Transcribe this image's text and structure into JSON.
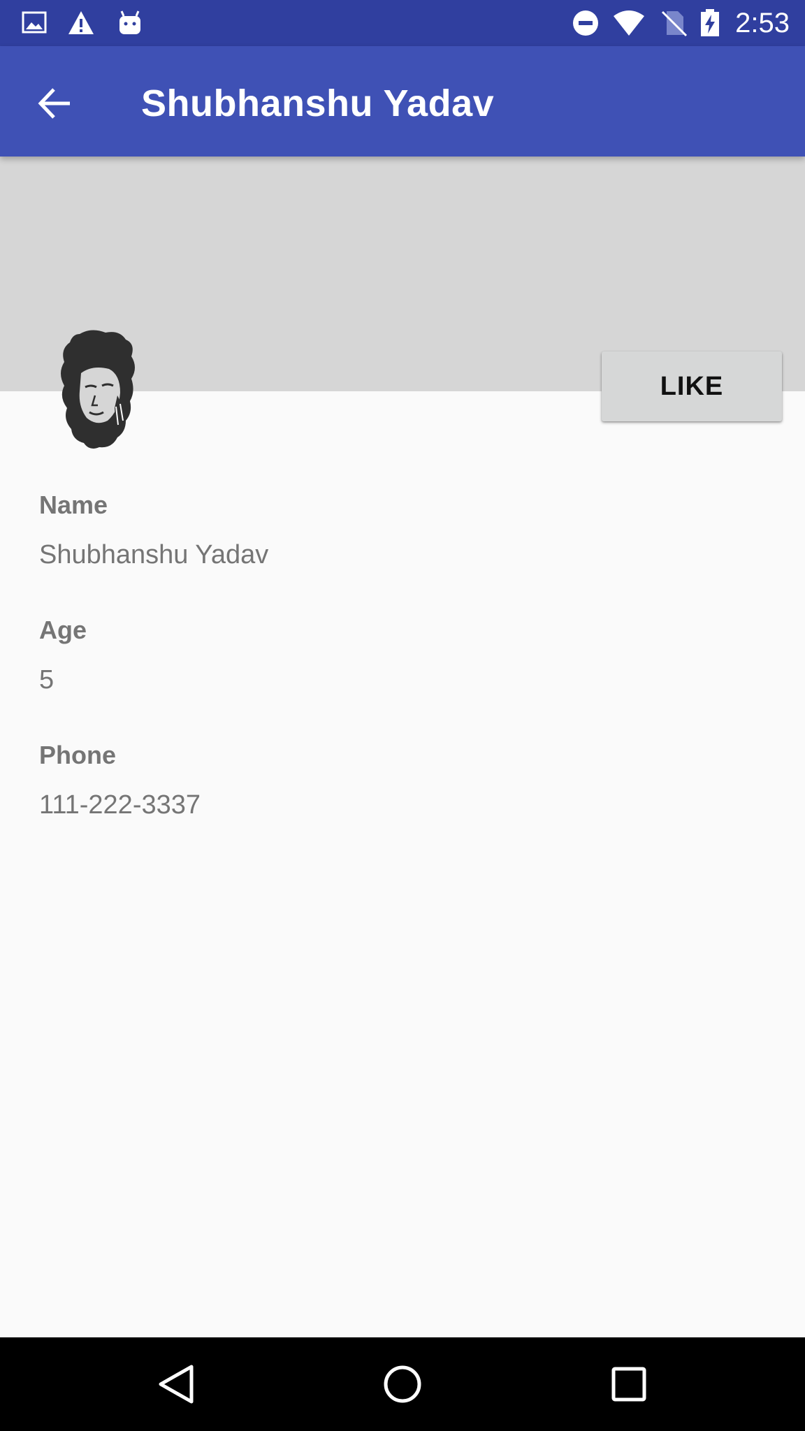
{
  "status_bar": {
    "time": "2:53",
    "icons": [
      "image-icon",
      "warning-icon",
      "android-icon",
      "do-not-disturb-icon",
      "wifi-icon",
      "no-sim-icon",
      "battery-charging-icon"
    ]
  },
  "app_bar": {
    "title": "Shubhanshu Yadav",
    "back_icon": "arrow-back-icon"
  },
  "profile": {
    "like_label": "LIKE",
    "fields": [
      {
        "label": "Name",
        "value": "Shubhanshu Yadav"
      },
      {
        "label": "Age",
        "value": "5"
      },
      {
        "label": "Phone",
        "value": "111-222-3337"
      }
    ]
  },
  "nav_bar": {
    "buttons": [
      "back-triangle-icon",
      "home-circle-icon",
      "recents-square-icon"
    ]
  },
  "colors": {
    "status_bar": "#303f9f",
    "app_bar": "#3f51b5",
    "header_bg": "#d6d6d6",
    "page_bg": "#fafafa",
    "text_secondary": "#757575"
  }
}
